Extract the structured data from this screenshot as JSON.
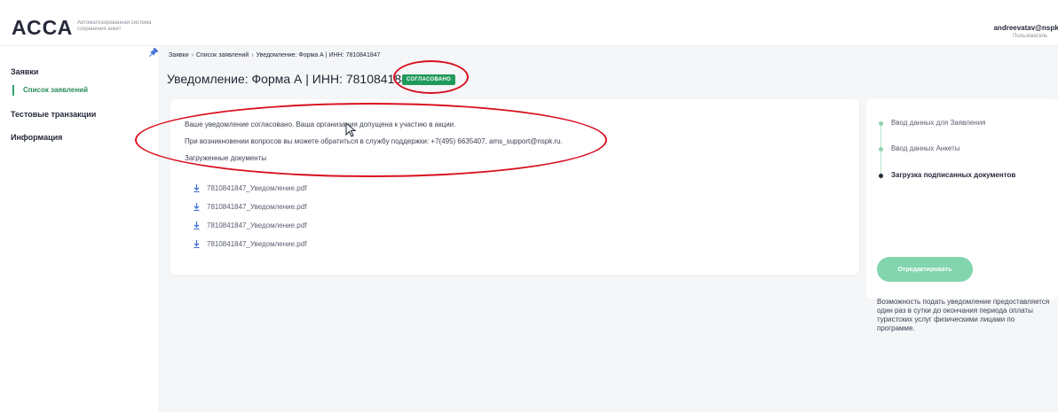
{
  "header": {
    "logo": "АССА",
    "logo_sub": "Автоматизированная система сохранения анкет",
    "user_name": "andreevatav@nspk.r",
    "user_role": "Пользователь"
  },
  "sidebar": {
    "items": [
      {
        "label": "Заявки"
      },
      {
        "label": "Список заявлений"
      },
      {
        "label": "Тестовые транзакции"
      },
      {
        "label": "Информация"
      }
    ]
  },
  "breadcrumb": [
    "Заявки",
    "Список заявлений",
    "Уведомление: Форма А | ИНН: 7810841847"
  ],
  "page": {
    "title": "Уведомление: Форма А | ИНН: 7810841847",
    "status": "СОГЛАСОВАНО"
  },
  "card": {
    "message1": "Ваше уведомление согласовано. Ваша организация допущена к участию в акции.",
    "message2": "При возникновении вопросов вы можете обратиться в службу поддержки: +7(495) 6635407, ams_support@nspk.ru.",
    "docs_label": "Загруженные документы",
    "docs": [
      "7810841847_Уведомление.pdf",
      "7810841847_Уведомление.pdf",
      "7810841847_Уведомление.pdf",
      "7810841847_Уведомление.pdf"
    ]
  },
  "steps": [
    {
      "label": "Ввод данных для Заявления"
    },
    {
      "label": "Ввод данных Анкеты"
    },
    {
      "label": "Загрузка подписанных документов"
    }
  ],
  "edit_button": "Отредактировать",
  "side_note": "Возможность подать уведомление предоставляется один раз в сутки до окончания периода оплаты туристских услуг физическими лицами по программе.",
  "colors": {
    "accent": "#1f9a5a",
    "annotation": "#d80f1e"
  }
}
